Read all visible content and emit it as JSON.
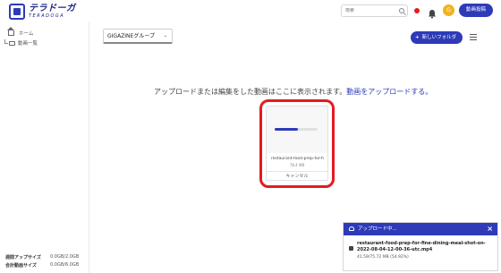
{
  "header": {
    "logo_jp": "テラドーガ",
    "logo_en": "TERADOGA",
    "search_placeholder": "検索",
    "avatar_letter": "G",
    "post_button": "動画投稿"
  },
  "sidebar": {
    "items": [
      {
        "label": "ホーム",
        "icon": "home-icon"
      },
      {
        "label": "動画一覧",
        "icon": "folder-icon"
      }
    ],
    "storage": [
      {
        "label": "週間アップサイズ",
        "value": "0.0GB/2.0GB"
      },
      {
        "label": "合計動画サイズ",
        "value": "0.0GB/6.0GB"
      }
    ]
  },
  "main": {
    "group_select": "GIGAZINEグループ",
    "new_folder_label": "新しいフォルダ",
    "message_text": "アップロードまたは編集をした動画はここに表示されます。",
    "message_link": "動画をアップロードする。",
    "card": {
      "file_name": "restaurant-food-prep-for-fi",
      "size": "78.4 MB",
      "cancel_label": "キャンセル",
      "progress": 0.55
    }
  },
  "upload_panel": {
    "title": "アップロード中...",
    "close": "×",
    "file_name": "restaurant-food-prep-for-fine-dining-meal-shot-on-2022-08-04-12-00-36-utc.mp4",
    "progress_text": "41.59/75.72 MB (54.92%)",
    "progress": 0.5492
  },
  "colors": {
    "brand": "#2d3bb8",
    "highlight": "#e31b23",
    "avatar": "#f0b323"
  }
}
